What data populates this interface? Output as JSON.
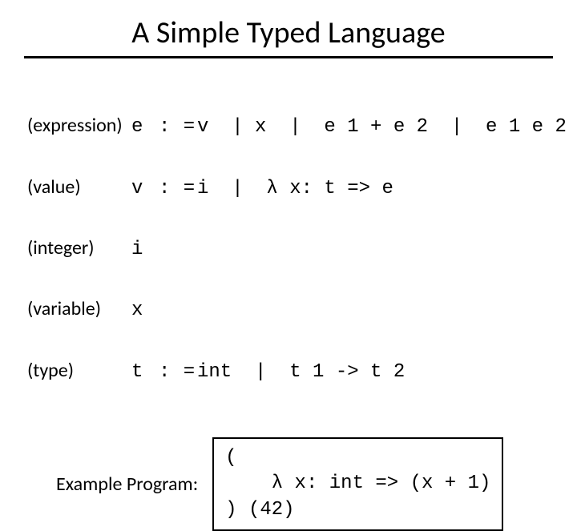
{
  "title": "A Simple Typed Language",
  "grammar": {
    "rows": [
      {
        "label": "(expression)",
        "sym": "e",
        "op": ": =",
        "rhs": "v  | x  |  e 1 + e 2  |  e 1 e 2"
      },
      {
        "label": "(value)",
        "sym": "v",
        "op": ": =",
        "rhs": "i  |  λ x: t => e"
      },
      {
        "label": "(integer)",
        "sym": "i",
        "op": "",
        "rhs": ""
      },
      {
        "label": "(variable)",
        "sym": "x",
        "op": "",
        "rhs": ""
      },
      {
        "label": "(type)",
        "sym": "t",
        "op": ": =",
        "rhs": "int  |  t 1 -> t 2"
      }
    ]
  },
  "example": {
    "label": "Example Program:",
    "code": "(\n    λ x: int => (x + 1)\n) (42)"
  }
}
